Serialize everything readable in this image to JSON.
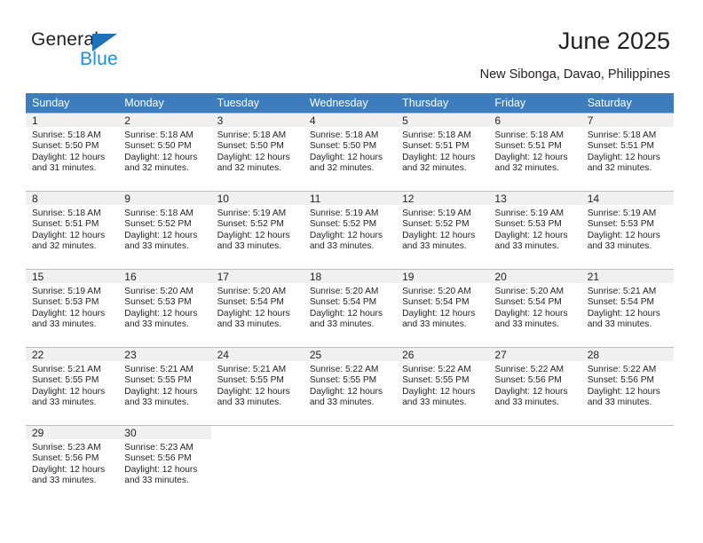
{
  "brand": {
    "name_top": "General",
    "name_bottom": "Blue",
    "accent_color": "#1d72bb",
    "accent_color_light": "#1d8fe0"
  },
  "header": {
    "title": "June 2025",
    "subtitle": "New Sibonga, Davao, Philippines"
  },
  "calendar": {
    "header_bg": "#3d7cbd",
    "daynum_bg": "#f0f0f0",
    "weekday_headers": [
      "Sunday",
      "Monday",
      "Tuesday",
      "Wednesday",
      "Thursday",
      "Friday",
      "Saturday"
    ],
    "weeks": [
      [
        {
          "day": "1",
          "sunrise": "Sunrise: 5:18 AM",
          "sunset": "Sunset: 5:50 PM",
          "daylight1": "Daylight: 12 hours",
          "daylight2": "and 31 minutes."
        },
        {
          "day": "2",
          "sunrise": "Sunrise: 5:18 AM",
          "sunset": "Sunset: 5:50 PM",
          "daylight1": "Daylight: 12 hours",
          "daylight2": "and 32 minutes."
        },
        {
          "day": "3",
          "sunrise": "Sunrise: 5:18 AM",
          "sunset": "Sunset: 5:50 PM",
          "daylight1": "Daylight: 12 hours",
          "daylight2": "and 32 minutes."
        },
        {
          "day": "4",
          "sunrise": "Sunrise: 5:18 AM",
          "sunset": "Sunset: 5:50 PM",
          "daylight1": "Daylight: 12 hours",
          "daylight2": "and 32 minutes."
        },
        {
          "day": "5",
          "sunrise": "Sunrise: 5:18 AM",
          "sunset": "Sunset: 5:51 PM",
          "daylight1": "Daylight: 12 hours",
          "daylight2": "and 32 minutes."
        },
        {
          "day": "6",
          "sunrise": "Sunrise: 5:18 AM",
          "sunset": "Sunset: 5:51 PM",
          "daylight1": "Daylight: 12 hours",
          "daylight2": "and 32 minutes."
        },
        {
          "day": "7",
          "sunrise": "Sunrise: 5:18 AM",
          "sunset": "Sunset: 5:51 PM",
          "daylight1": "Daylight: 12 hours",
          "daylight2": "and 32 minutes."
        }
      ],
      [
        {
          "day": "8",
          "sunrise": "Sunrise: 5:18 AM",
          "sunset": "Sunset: 5:51 PM",
          "daylight1": "Daylight: 12 hours",
          "daylight2": "and 32 minutes."
        },
        {
          "day": "9",
          "sunrise": "Sunrise: 5:18 AM",
          "sunset": "Sunset: 5:52 PM",
          "daylight1": "Daylight: 12 hours",
          "daylight2": "and 33 minutes."
        },
        {
          "day": "10",
          "sunrise": "Sunrise: 5:19 AM",
          "sunset": "Sunset: 5:52 PM",
          "daylight1": "Daylight: 12 hours",
          "daylight2": "and 33 minutes."
        },
        {
          "day": "11",
          "sunrise": "Sunrise: 5:19 AM",
          "sunset": "Sunset: 5:52 PM",
          "daylight1": "Daylight: 12 hours",
          "daylight2": "and 33 minutes."
        },
        {
          "day": "12",
          "sunrise": "Sunrise: 5:19 AM",
          "sunset": "Sunset: 5:52 PM",
          "daylight1": "Daylight: 12 hours",
          "daylight2": "and 33 minutes."
        },
        {
          "day": "13",
          "sunrise": "Sunrise: 5:19 AM",
          "sunset": "Sunset: 5:53 PM",
          "daylight1": "Daylight: 12 hours",
          "daylight2": "and 33 minutes."
        },
        {
          "day": "14",
          "sunrise": "Sunrise: 5:19 AM",
          "sunset": "Sunset: 5:53 PM",
          "daylight1": "Daylight: 12 hours",
          "daylight2": "and 33 minutes."
        }
      ],
      [
        {
          "day": "15",
          "sunrise": "Sunrise: 5:19 AM",
          "sunset": "Sunset: 5:53 PM",
          "daylight1": "Daylight: 12 hours",
          "daylight2": "and 33 minutes."
        },
        {
          "day": "16",
          "sunrise": "Sunrise: 5:20 AM",
          "sunset": "Sunset: 5:53 PM",
          "daylight1": "Daylight: 12 hours",
          "daylight2": "and 33 minutes."
        },
        {
          "day": "17",
          "sunrise": "Sunrise: 5:20 AM",
          "sunset": "Sunset: 5:54 PM",
          "daylight1": "Daylight: 12 hours",
          "daylight2": "and 33 minutes."
        },
        {
          "day": "18",
          "sunrise": "Sunrise: 5:20 AM",
          "sunset": "Sunset: 5:54 PM",
          "daylight1": "Daylight: 12 hours",
          "daylight2": "and 33 minutes."
        },
        {
          "day": "19",
          "sunrise": "Sunrise: 5:20 AM",
          "sunset": "Sunset: 5:54 PM",
          "daylight1": "Daylight: 12 hours",
          "daylight2": "and 33 minutes."
        },
        {
          "day": "20",
          "sunrise": "Sunrise: 5:20 AM",
          "sunset": "Sunset: 5:54 PM",
          "daylight1": "Daylight: 12 hours",
          "daylight2": "and 33 minutes."
        },
        {
          "day": "21",
          "sunrise": "Sunrise: 5:21 AM",
          "sunset": "Sunset: 5:54 PM",
          "daylight1": "Daylight: 12 hours",
          "daylight2": "and 33 minutes."
        }
      ],
      [
        {
          "day": "22",
          "sunrise": "Sunrise: 5:21 AM",
          "sunset": "Sunset: 5:55 PM",
          "daylight1": "Daylight: 12 hours",
          "daylight2": "and 33 minutes."
        },
        {
          "day": "23",
          "sunrise": "Sunrise: 5:21 AM",
          "sunset": "Sunset: 5:55 PM",
          "daylight1": "Daylight: 12 hours",
          "daylight2": "and 33 minutes."
        },
        {
          "day": "24",
          "sunrise": "Sunrise: 5:21 AM",
          "sunset": "Sunset: 5:55 PM",
          "daylight1": "Daylight: 12 hours",
          "daylight2": "and 33 minutes."
        },
        {
          "day": "25",
          "sunrise": "Sunrise: 5:22 AM",
          "sunset": "Sunset: 5:55 PM",
          "daylight1": "Daylight: 12 hours",
          "daylight2": "and 33 minutes."
        },
        {
          "day": "26",
          "sunrise": "Sunrise: 5:22 AM",
          "sunset": "Sunset: 5:55 PM",
          "daylight1": "Daylight: 12 hours",
          "daylight2": "and 33 minutes."
        },
        {
          "day": "27",
          "sunrise": "Sunrise: 5:22 AM",
          "sunset": "Sunset: 5:56 PM",
          "daylight1": "Daylight: 12 hours",
          "daylight2": "and 33 minutes."
        },
        {
          "day": "28",
          "sunrise": "Sunrise: 5:22 AM",
          "sunset": "Sunset: 5:56 PM",
          "daylight1": "Daylight: 12 hours",
          "daylight2": "and 33 minutes."
        }
      ],
      [
        {
          "day": "29",
          "sunrise": "Sunrise: 5:23 AM",
          "sunset": "Sunset: 5:56 PM",
          "daylight1": "Daylight: 12 hours",
          "daylight2": "and 33 minutes."
        },
        {
          "day": "30",
          "sunrise": "Sunrise: 5:23 AM",
          "sunset": "Sunset: 5:56 PM",
          "daylight1": "Daylight: 12 hours",
          "daylight2": "and 33 minutes."
        },
        {
          "day": "",
          "sunrise": "",
          "sunset": "",
          "daylight1": "",
          "daylight2": ""
        },
        {
          "day": "",
          "sunrise": "",
          "sunset": "",
          "daylight1": "",
          "daylight2": ""
        },
        {
          "day": "",
          "sunrise": "",
          "sunset": "",
          "daylight1": "",
          "daylight2": ""
        },
        {
          "day": "",
          "sunrise": "",
          "sunset": "",
          "daylight1": "",
          "daylight2": ""
        },
        {
          "day": "",
          "sunrise": "",
          "sunset": "",
          "daylight1": "",
          "daylight2": ""
        }
      ]
    ]
  }
}
